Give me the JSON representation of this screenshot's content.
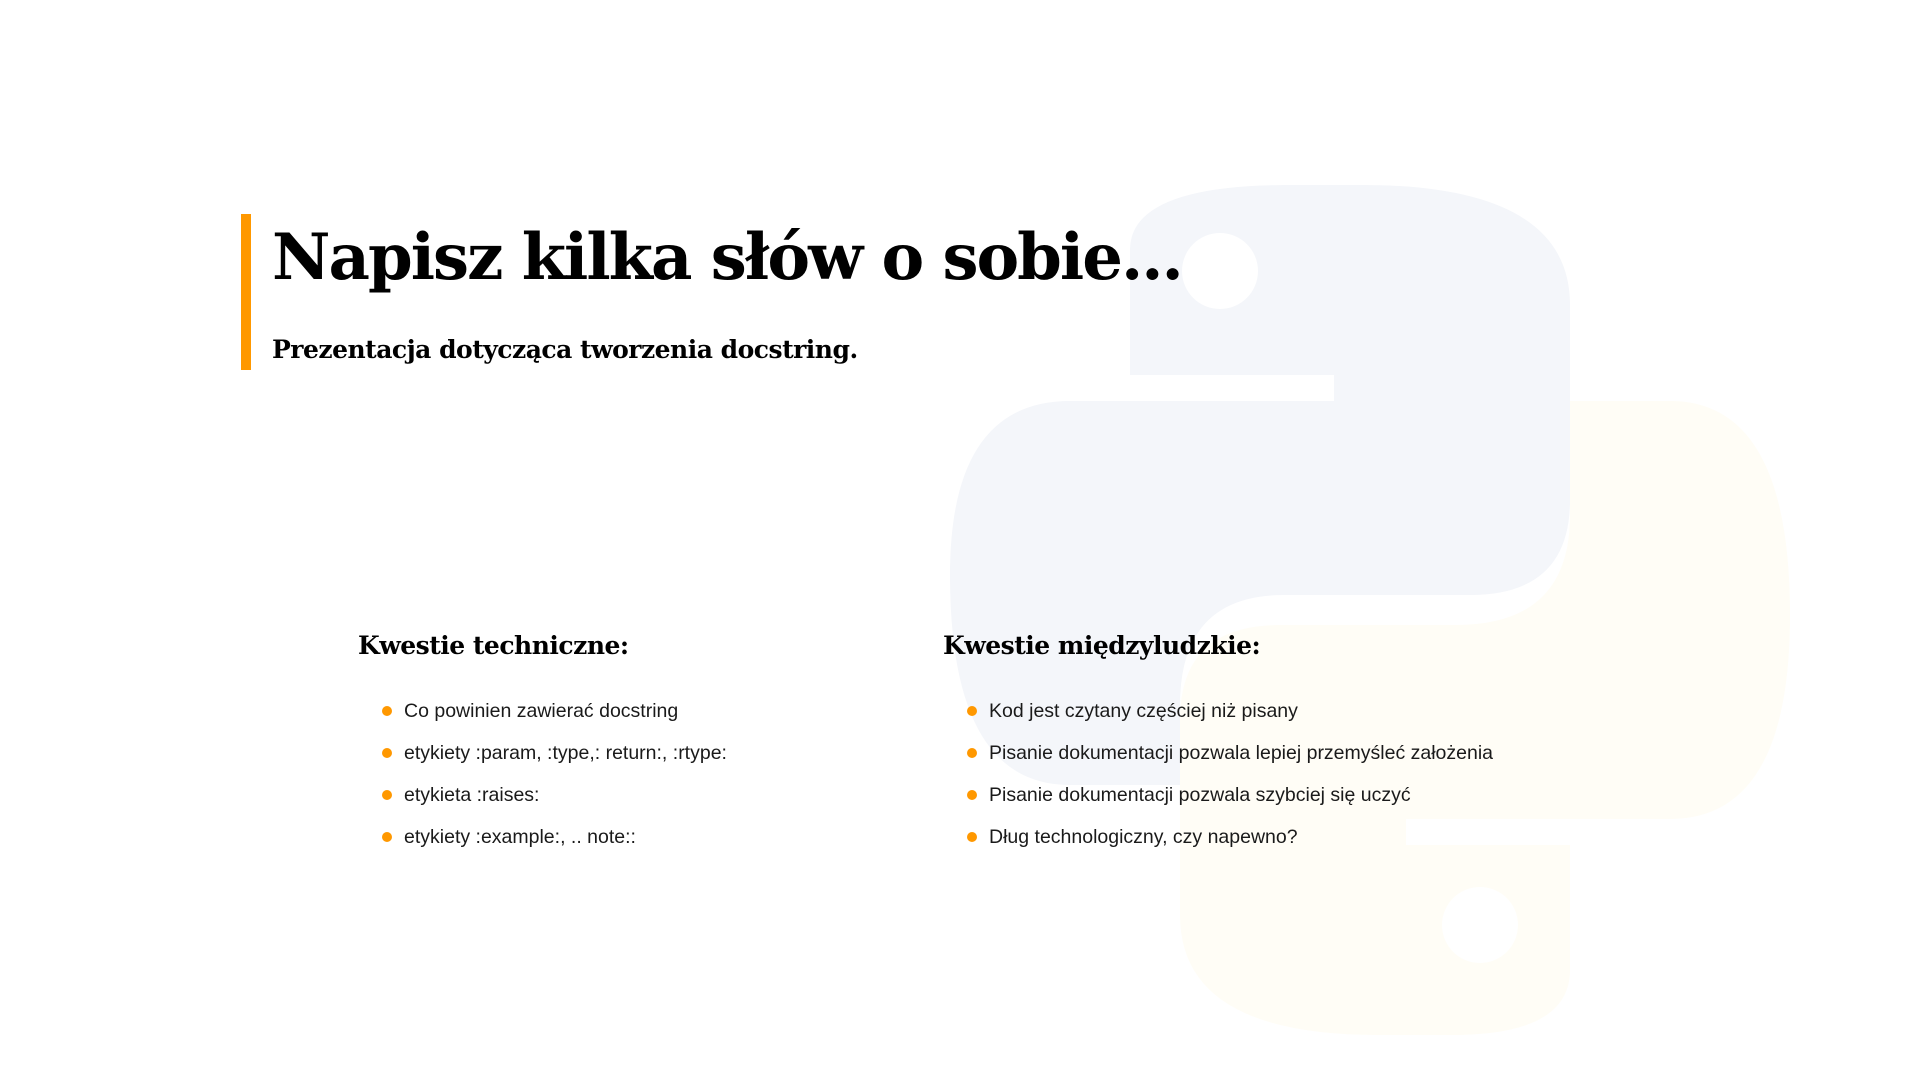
{
  "colors": {
    "accent": "#ff9800",
    "logo_top": "#f4f6fa",
    "logo_bottom": "#fffdf6",
    "text": "#000000"
  },
  "background_icon": "python-logo-icon",
  "header": {
    "title": "Napisz kilka słów o sobie...",
    "subtitle": "Prezentacja dotycząca tworzenia docstring."
  },
  "columns": [
    {
      "heading": "Kwestie techniczne:",
      "items": [
        "Co powinien zawierać docstring",
        "etykiety :param, :type,: return:, :rtype:",
        "etykieta :raises:",
        "etykiety :example:, .. note::"
      ]
    },
    {
      "heading": "Kwestie międzyludzkie:",
      "items": [
        "Kod jest czytany częściej niż pisany",
        "Pisanie dokumentacji pozwala lepiej przemyśleć założenia",
        "Pisanie dokumentacji pozwala szybciej się uczyć",
        "Dług technologiczny, czy napewno?"
      ]
    }
  ]
}
